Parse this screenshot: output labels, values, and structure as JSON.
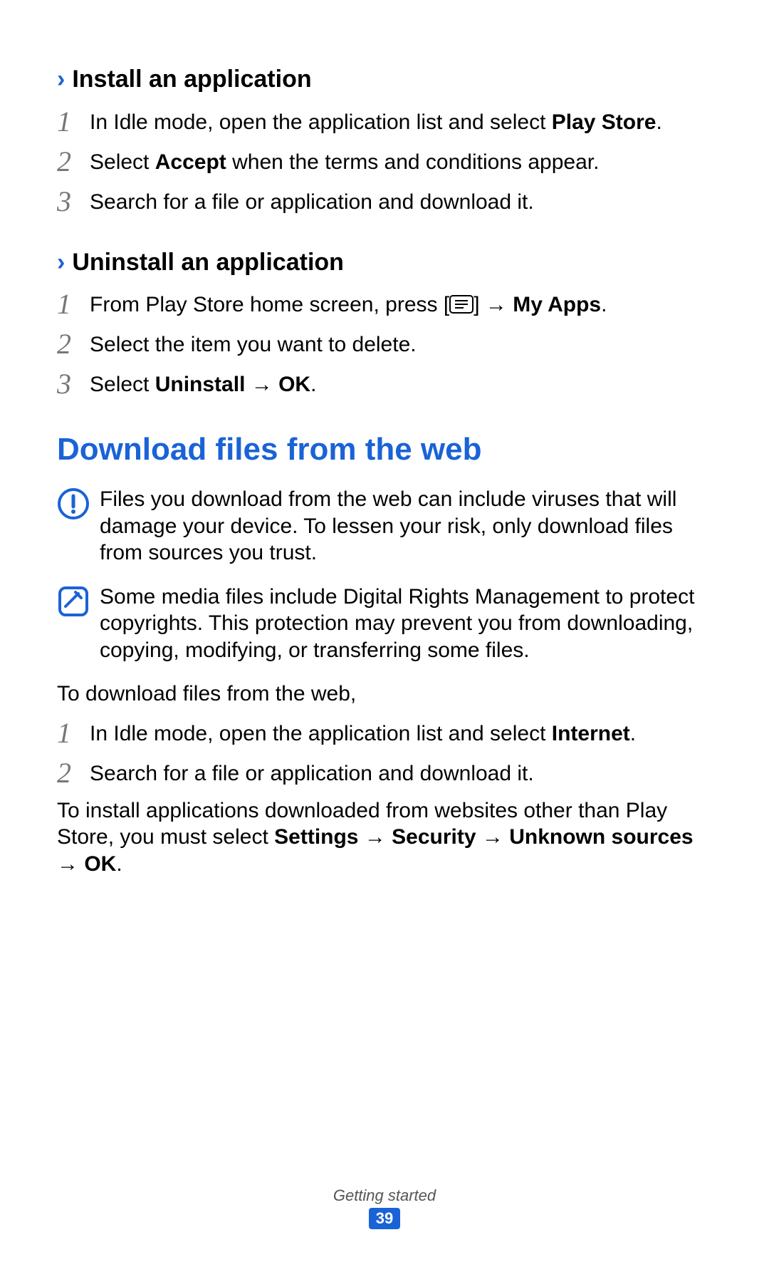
{
  "section1": {
    "heading": "Install an application",
    "steps": [
      {
        "pre": "In Idle mode, open the application list and select ",
        "bold1": "Play Store",
        "post": "."
      },
      {
        "pre": "Select ",
        "bold1": "Accept",
        "post": " when the terms and conditions appear."
      },
      {
        "pre": "Search for a file or application and download it."
      }
    ]
  },
  "section2": {
    "heading": "Uninstall an application",
    "steps": [
      {
        "pre": "From Play Store home screen, press [",
        "icon": true,
        "mid": "] → ",
        "bold1": "My Apps",
        "post": "."
      },
      {
        "pre": "Select the item you want to delete."
      },
      {
        "pre": "Select ",
        "bold1": "Uninstall → OK",
        "post": "."
      }
    ]
  },
  "download": {
    "title": "Download files from the web",
    "warning": "Files you download from the web can include viruses that will damage your device. To lessen your risk, only download files from sources you trust.",
    "note": "Some media files include Digital Rights Management to protect copyrights. This protection may prevent you from downloading, copying, modifying, or transferring some files.",
    "intro": "To download files from the web,",
    "steps": [
      {
        "pre": "In Idle mode, open the application list and select ",
        "bold1": "Internet",
        "post": "."
      },
      {
        "pre": "Search for a file or application and download it."
      }
    ],
    "outro_pre": "To install applications downloaded from websites other than Play Store, you must select ",
    "outro_bold": "Settings → Security → Unknown sources → OK",
    "outro_post": "."
  },
  "footer": {
    "section": "Getting started",
    "page": "39"
  }
}
